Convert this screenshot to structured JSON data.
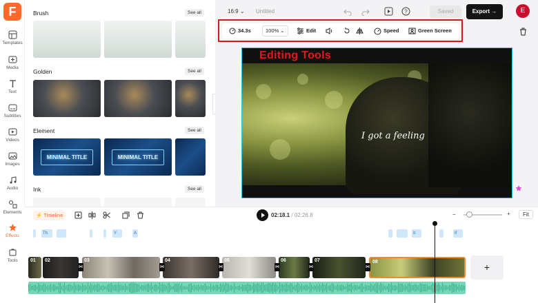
{
  "app": {
    "logo": "F"
  },
  "sidebar": {
    "items": [
      {
        "label": "Templates",
        "icon": "templates-icon"
      },
      {
        "label": "Media",
        "icon": "media-icon"
      },
      {
        "label": "Text",
        "icon": "text-icon"
      },
      {
        "label": "Subtitles",
        "icon": "subtitles-icon"
      },
      {
        "label": "Videos",
        "icon": "videos-icon"
      },
      {
        "label": "Images",
        "icon": "images-icon"
      },
      {
        "label": "Audio",
        "icon": "audio-icon"
      },
      {
        "label": "Elements",
        "icon": "elements-icon"
      },
      {
        "label": "Effects",
        "icon": "effects-icon"
      },
      {
        "label": "Tools",
        "icon": "tools-icon"
      }
    ],
    "active": "Effects"
  },
  "panel": {
    "sections": [
      {
        "title": "Brush",
        "see_all": "See all"
      },
      {
        "title": "Golden",
        "see_all": "See all"
      },
      {
        "title": "Element",
        "see_all": "See all",
        "thumb_text": "MINIMAL TITLE"
      },
      {
        "title": "Ink",
        "see_all": "See all"
      }
    ]
  },
  "topbar": {
    "aspect": "16:9",
    "project_name": "Untitled",
    "saved_label": "Saved",
    "export_label": "Export",
    "avatar_letter": "E"
  },
  "toolbar": {
    "duration": "34.3s",
    "zoom": "100%",
    "edit_label": "Edit",
    "speed_label": "Speed",
    "green_screen_label": "Green Screen"
  },
  "annotation": {
    "label": "Editing Tools",
    "color": "#e6161b"
  },
  "canvas": {
    "caption": "I got a feeling"
  },
  "timeline": {
    "tab_label": "Timeline",
    "current_time": "02:18.1",
    "separator": "/",
    "total_time": "02:26.8",
    "fit_label": "Fit",
    "text_chips": [
      "Th",
      "",
      "",
      "",
      "Y",
      "A",
      "",
      "",
      "It",
      "",
      "If"
    ],
    "clips": [
      "01",
      "02",
      "03",
      "04",
      "05",
      "06",
      "07",
      "08"
    ]
  },
  "colors": {
    "accent": "#ff6a2b",
    "selection": "#27c3d9",
    "audio": "#74d8b8",
    "export_bg": "#141414"
  }
}
